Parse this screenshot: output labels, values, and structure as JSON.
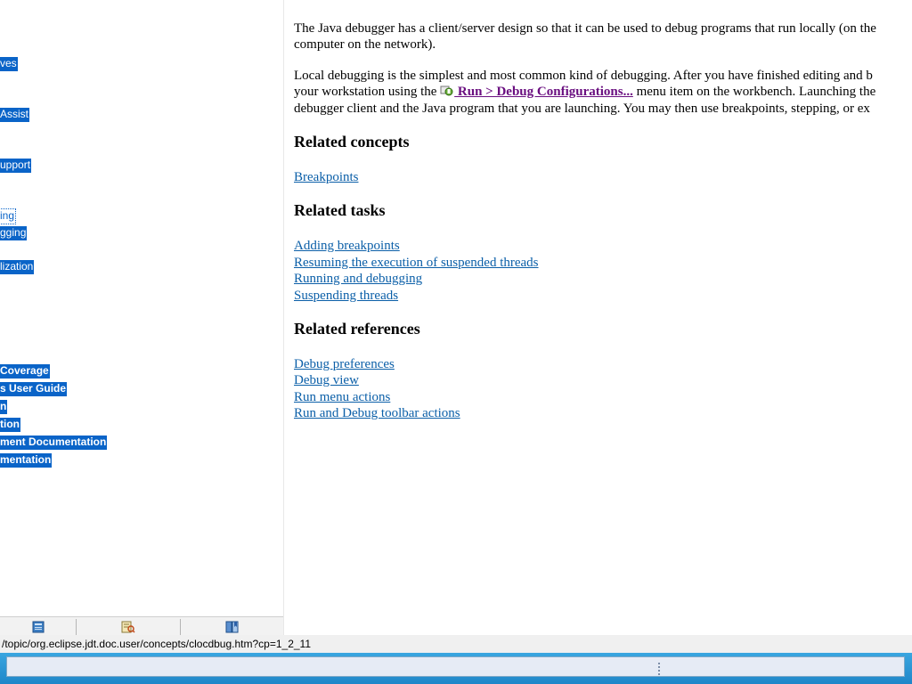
{
  "nav": {
    "items": [
      {
        "label": "ves",
        "bold": false,
        "focused": false
      },
      {
        "label": "Assist",
        "bold": false,
        "focused": false
      },
      {
        "label": "upport",
        "bold": false,
        "focused": false
      },
      {
        "label": "ing",
        "bold": false,
        "focused": true
      },
      {
        "label": "gging",
        "bold": false,
        "focused": false
      },
      {
        "label": "lization",
        "bold": false,
        "focused": false
      },
      {
        "label": " Coverage",
        "bold": true,
        "focused": false
      },
      {
        "label": "s User Guide",
        "bold": true,
        "focused": false
      },
      {
        "label": "n",
        "bold": true,
        "focused": false
      },
      {
        "label": "tion",
        "bold": true,
        "focused": false
      },
      {
        "label": "ment Documentation",
        "bold": true,
        "focused": false
      },
      {
        "label": "mentation",
        "bold": true,
        "focused": false
      }
    ],
    "toolbar_icons": [
      "contents-icon",
      "search-results-icon",
      "bookmarks-icon"
    ]
  },
  "content": {
    "p1_line1": "The Java debugger has a client/server design so that it can be used to debug programs that run locally (on the",
    "p1_line2": "computer on the network).",
    "p2_line1": "Local debugging is the simplest and most common kind of debugging.  After you have finished editing and b",
    "p2_line2_pre": "your workstation using the ",
    "p2_command": " Run > Debug Configurations...",
    "p2_line2_post": " menu item on the workbench.  Launching the",
    "p2_line3": "debugger client and the Java program that you are launching.  You may then use breakpoints, stepping, or ex",
    "sections": [
      {
        "heading": "Related concepts",
        "links": [
          "Breakpoints"
        ]
      },
      {
        "heading": "Related tasks",
        "links": [
          "Adding breakpoints",
          "Resuming the execution of suspended threads",
          "Running and debugging",
          "Suspending threads"
        ]
      },
      {
        "heading": "Related references",
        "links": [
          "Debug preferences",
          "Debug view",
          "Run menu actions",
          "Run and Debug toolbar actions"
        ]
      }
    ]
  },
  "status_bar": {
    "url": "/topic/org.eclipse.jdt.doc.user/concepts/clocdbug.htm?cp=1_2_11"
  },
  "colors": {
    "selection": "#0a64c8",
    "link": "#0b5fa8",
    "visited_command": "#6a0f80",
    "taskbar": "#2a95d4"
  }
}
